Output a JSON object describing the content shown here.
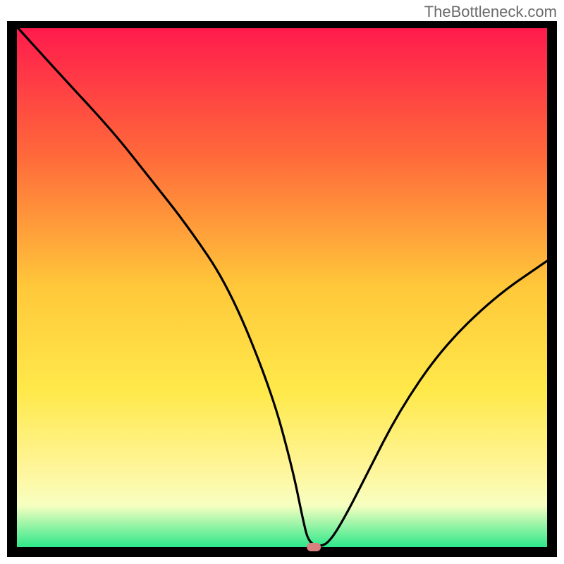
{
  "watermark": "TheBottleneck.com",
  "chart_data": {
    "type": "line",
    "title": "",
    "xlabel": "",
    "ylabel": "",
    "xlim": [
      0,
      100
    ],
    "ylim": [
      0,
      100
    ],
    "background": {
      "type": "vertical-gradient",
      "stops": [
        {
          "offset": 0,
          "color": "#ff1a4d"
        },
        {
          "offset": 25,
          "color": "#ff6a3a"
        },
        {
          "offset": 50,
          "color": "#ffc83a"
        },
        {
          "offset": 70,
          "color": "#ffe94a"
        },
        {
          "offset": 85,
          "color": "#fff59a"
        },
        {
          "offset": 92,
          "color": "#f7ffc0"
        },
        {
          "offset": 100,
          "color": "#2ee88a"
        }
      ]
    },
    "marker": {
      "x": 56,
      "y": 0,
      "color": "#d98080",
      "shape": "rounded-rect"
    },
    "series": [
      {
        "name": "bottleneck-curve",
        "color": "#000000",
        "x": [
          0,
          8,
          18,
          25,
          32,
          40,
          48,
          52,
          54,
          55,
          57,
          59,
          62,
          66,
          72,
          80,
          90,
          100
        ],
        "values": [
          100,
          91,
          80,
          71,
          62,
          50,
          30,
          15,
          5,
          1,
          0,
          1,
          6,
          14,
          26,
          38,
          48,
          55
        ]
      }
    ]
  }
}
